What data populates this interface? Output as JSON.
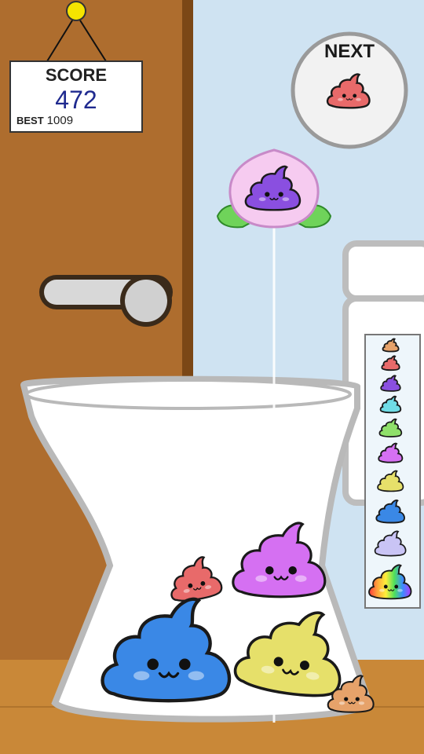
{
  "score_panel": {
    "title": "SCORE",
    "score": "472",
    "best_label": "BEST",
    "best_value": "1009"
  },
  "next_panel": {
    "title": "NEXT",
    "next_piece": "red-poop"
  },
  "current_piece": "purple-poop",
  "evolution_chain": [
    "brown-poop",
    "red-poop",
    "purple-poop",
    "cyan-poop",
    "green-poop",
    "magenta-poop",
    "yellow-poop",
    "blue-poop",
    "lavender-poop",
    "rainbow-poop"
  ],
  "colors": {
    "wall": "#cfe3f2",
    "door": "#a9692b",
    "floor": "#c98838",
    "score_text": "#1f2a8f",
    "red": "#e86a6a",
    "purple": "#8a4fe0",
    "magenta": "#d570f2",
    "blue": "#3a88e6",
    "yellow": "#e6e06a",
    "brown": "#e6a26a"
  }
}
